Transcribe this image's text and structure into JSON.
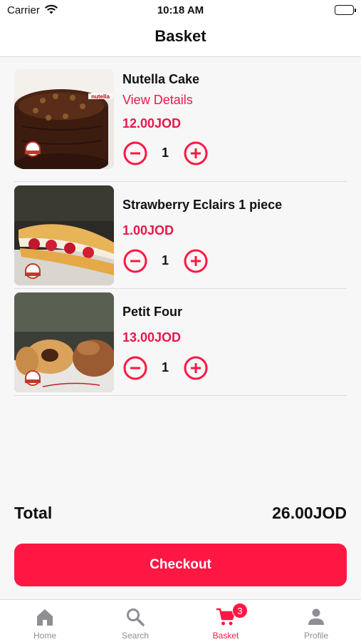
{
  "status_bar": {
    "carrier": "Carrier",
    "time": "10:18 AM"
  },
  "header": {
    "title": "Basket"
  },
  "items": [
    {
      "name": "Nutella Cake",
      "view_details": "View Details",
      "price": "12.00JOD",
      "quantity": "1"
    },
    {
      "name": "Strawberry Eclairs 1 piece",
      "price": "1.00JOD",
      "quantity": "1"
    },
    {
      "name": "Petit Four",
      "price": "13.00JOD",
      "quantity": "1"
    }
  ],
  "summary": {
    "total_label": "Total",
    "total_value": "26.00JOD"
  },
  "checkout_label": "Checkout",
  "tabs": [
    {
      "label": "Home",
      "icon": "home-icon"
    },
    {
      "label": "Search",
      "icon": "search-icon"
    },
    {
      "label": "Basket",
      "icon": "cart-icon",
      "badge": "3",
      "active": true
    },
    {
      "label": "Profile",
      "icon": "profile-icon"
    }
  ],
  "colors": {
    "accent": "#ff1744",
    "price": "#e8174a",
    "inactive_tab": "#8e8e93"
  }
}
